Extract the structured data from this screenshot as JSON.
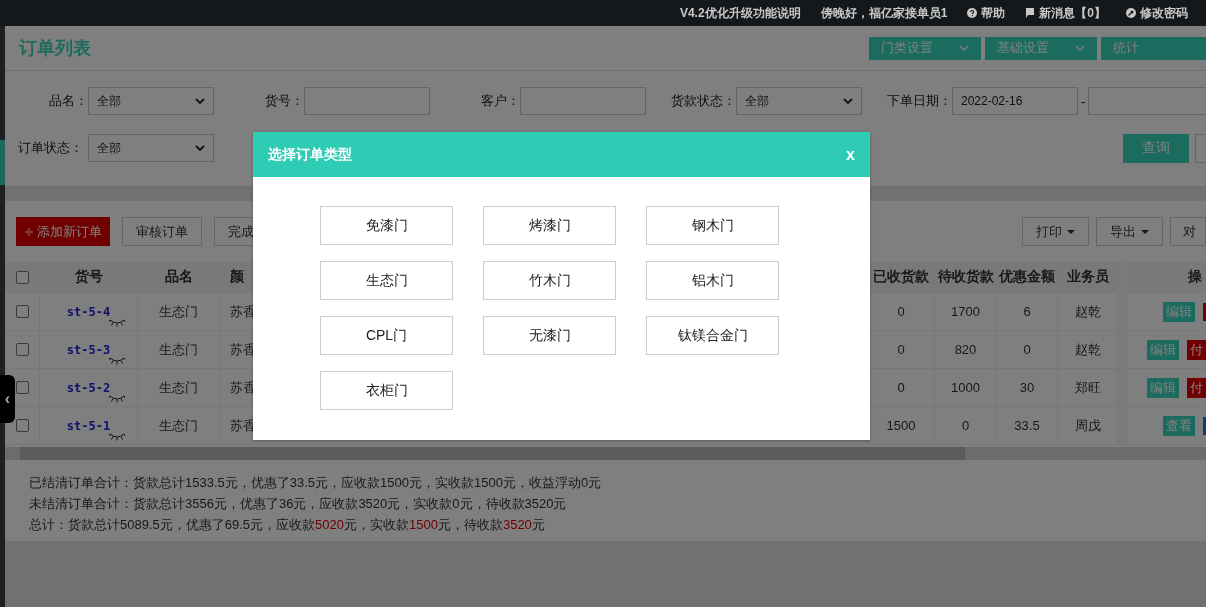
{
  "top_bar": {
    "links": [
      {
        "kind": "plain",
        "text": "V4.2优化升级功能说明"
      },
      {
        "kind": "plain",
        "text": "傍晚好，福亿家接单员1"
      },
      {
        "kind": "help",
        "text": "帮助"
      },
      {
        "kind": "flag",
        "text": "新消息【0】"
      },
      {
        "kind": "key",
        "text": "修改密码"
      }
    ]
  },
  "page": {
    "title": "订单列表",
    "header_buttons": [
      {
        "label": "门类设置",
        "dropdown": true
      },
      {
        "label": "基础设置",
        "dropdown": true
      },
      {
        "label": "统计",
        "dropdown": false
      }
    ],
    "filters": [
      {
        "kind": "select",
        "label": "品名：",
        "value": "全部"
      },
      {
        "kind": "input",
        "label": "货号："
      },
      {
        "kind": "input",
        "label": "客户："
      },
      {
        "kind": "select",
        "label": "货款状态：",
        "value": "全部"
      },
      {
        "kind": "daterange",
        "label": "下单日期：",
        "value": "2022-02-16",
        "separator": "-"
      }
    ],
    "filters_row2": [
      {
        "kind": "select",
        "label": "订单状态：",
        "value": "全部"
      }
    ],
    "query_button": "查询"
  },
  "toolbar": {
    "left": [
      {
        "kind": "add",
        "label": "添加新订单"
      },
      {
        "kind": "plain",
        "label": "审核订单"
      },
      {
        "kind": "plain",
        "label": "完成"
      }
    ],
    "right": [
      {
        "label": "打印",
        "dropdown": true
      },
      {
        "label": "导出",
        "dropdown": true
      },
      {
        "label": "对"
      }
    ]
  },
  "table": {
    "header_checked": false,
    "columns": [
      "货号",
      "品名",
      "颜",
      "已收货款",
      "待收货款",
      "优惠金额",
      "业务员",
      "操"
    ],
    "rows": [
      {
        "checked": false,
        "sku": "st-5-4",
        "product": "生态门",
        "finish": "苏香",
        "received": "0",
        "pending": "1700",
        "discount": "6",
        "salesman": "赵乾",
        "actions": [
          {
            "kind": "edit",
            "label": "编辑"
          },
          {
            "kind": "pay"
          }
        ]
      },
      {
        "checked": false,
        "sku": "st-5-3",
        "product": "生态门",
        "finish": "苏香",
        "received": "0",
        "pending": "820",
        "discount": "0",
        "salesman": "赵乾",
        "actions": [
          {
            "kind": "edit",
            "label": "编辑"
          },
          {
            "kind": "pay",
            "label": "付"
          }
        ]
      },
      {
        "checked": false,
        "sku": "st-5-2",
        "product": "生态门",
        "finish": "苏香",
        "received": "0",
        "pending": "1000",
        "discount": "30",
        "salesman": "郑旺",
        "actions": [
          {
            "kind": "edit",
            "label": "编辑"
          },
          {
            "kind": "pay",
            "label": "付"
          }
        ]
      },
      {
        "checked": false,
        "sku": "st-5-1",
        "product": "生态门",
        "finish": "苏香",
        "received": "1500",
        "pending": "0",
        "discount": "33.5",
        "salesman": "周戊",
        "actions": [
          {
            "kind": "view",
            "label": "查看"
          },
          {
            "kind": "more"
          }
        ]
      }
    ]
  },
  "summary": [
    [
      {
        "text": "已结清订单合计：货款总计1533.5元，优惠了33.5元，应收款1500元，实收款1500元，收益浮动0元",
        "highlight": false
      }
    ],
    [
      {
        "text": "未结清订单合计：货款总计3556元，优惠了36元，应收款3520元，实收款0元，待收款3520元",
        "highlight": false
      }
    ],
    [
      {
        "text": "总计：货款总计5089.5元，优惠了69.5元，应收款",
        "highlight": false
      },
      {
        "text": "5020",
        "highlight": true
      },
      {
        "text": "元，实收款",
        "highlight": false
      },
      {
        "text": "1500",
        "highlight": true
      },
      {
        "text": "元，待收款",
        "highlight": false
      },
      {
        "text": "3520",
        "highlight": true
      },
      {
        "text": "元",
        "highlight": false
      }
    ]
  ],
  "modal": {
    "title": "选择订单类型",
    "close": "x",
    "options": [
      "免漆门",
      "烤漆门",
      "钢木门",
      "生态门",
      "竹木门",
      "铝木门",
      "CPL门",
      "无漆门",
      "钛镁合金门",
      "衣柜门"
    ]
  },
  "sidebar_toggle": "‹"
}
